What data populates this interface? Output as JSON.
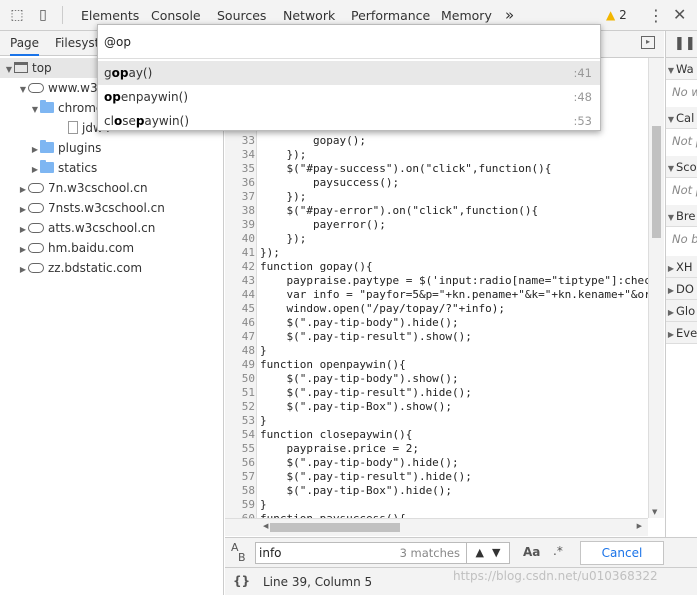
{
  "toolbar": {
    "tabs": [
      "Elements",
      "Console",
      "Sources",
      "Network",
      "Performance",
      "Memory"
    ],
    "more": "»",
    "warnings_count": "2"
  },
  "left_panel": {
    "tabs": [
      "Page",
      "Filesyste"
    ],
    "tree": [
      {
        "label": "top",
        "kind": "frame",
        "arrow": "▼"
      },
      {
        "label": "www.w3c",
        "kind": "cloud",
        "arrow": "▼"
      },
      {
        "label": "chrome",
        "kind": "folder",
        "arrow": "▼"
      },
      {
        "label": "jdw4",
        "kind": "file",
        "arrow": ""
      },
      {
        "label": "plugins",
        "kind": "folder",
        "arrow": "▶"
      },
      {
        "label": "statics",
        "kind": "folder",
        "arrow": "▶"
      },
      {
        "label": "7n.w3cschool.cn",
        "kind": "cloud",
        "arrow": "▶"
      },
      {
        "label": "7nsts.w3cschool.cn",
        "kind": "cloud",
        "arrow": "▶"
      },
      {
        "label": "atts.w3cschool.cn",
        "kind": "cloud",
        "arrow": "▶"
      },
      {
        "label": "hm.baidu.com",
        "kind": "cloud",
        "arrow": "▶"
      },
      {
        "label": "zz.bdstatic.com",
        "kind": "cloud",
        "arrow": "▶"
      }
    ]
  },
  "quick_open": {
    "query": "@op",
    "items": [
      {
        "pre": "g",
        "b1": "op",
        "mid": "ay()",
        "b2": "",
        "post": "",
        "line": ":41"
      },
      {
        "pre": "",
        "b1": "op",
        "mid": "enpaywin()",
        "b2": "",
        "post": "",
        "line": ":48"
      },
      {
        "pre": "cl",
        "b1": "o",
        "mid": "se",
        "b2": "p",
        "post": "aywin()",
        "line": ":53"
      }
    ]
  },
  "editor": {
    "lines": [
      {
        "n": "33",
        "t": "        gopay();"
      },
      {
        "n": "34",
        "t": "    });"
      },
      {
        "n": "35",
        "t": "    $(\"#pay-success\").on(\"click\",function(){"
      },
      {
        "n": "36",
        "t": "        paysuccess();"
      },
      {
        "n": "37",
        "t": "    });"
      },
      {
        "n": "38",
        "t": "    $(\"#pay-error\").on(\"click\",function(){"
      },
      {
        "n": "39",
        "t": "        payerror();"
      },
      {
        "n": "40",
        "t": "    });"
      },
      {
        "n": "41",
        "t": "});"
      },
      {
        "n": "42",
        "t": "function gopay(){"
      },
      {
        "n": "43",
        "t": "    paypraise.paytype = $('input:radio[name=\"tiptype\"]:chec"
      },
      {
        "n": "44",
        "t": "    var info = \"payfor=5&p=\"+kn.pename+\"&k=\"+kn.kename+\"&or"
      },
      {
        "n": "45",
        "t": "    window.open(\"/pay/topay/?\"+info);"
      },
      {
        "n": "46",
        "t": "    $(\".pay-tip-body\").hide();"
      },
      {
        "n": "47",
        "t": "    $(\".pay-tip-result\").show();"
      },
      {
        "n": "48",
        "t": "}"
      },
      {
        "n": "49",
        "t": "function openpaywin(){"
      },
      {
        "n": "50",
        "t": "    $(\".pay-tip-body\").show();"
      },
      {
        "n": "51",
        "t": "    $(\".pay-tip-result\").hide();"
      },
      {
        "n": "52",
        "t": "    $(\".pay-tip-Box\").show();"
      },
      {
        "n": "53",
        "t": "}"
      },
      {
        "n": "54",
        "t": "function closepaywin(){"
      },
      {
        "n": "55",
        "t": "    paypraise.price = 2;"
      },
      {
        "n": "56",
        "t": "    $(\".pay-tip-body\").hide();"
      },
      {
        "n": "57",
        "t": "    $(\".pay-tip-result\").hide();"
      },
      {
        "n": "58",
        "t": "    $(\".pay-tip-Box\").hide();"
      },
      {
        "n": "59",
        "t": "}"
      },
      {
        "n": "60",
        "t": "function paysuccess(){"
      }
    ]
  },
  "right_panel": {
    "sections": [
      {
        "label": "Wa",
        "note": "No w"
      },
      {
        "label": "Cal",
        "note": "Not p"
      },
      {
        "label": "Sco",
        "note": "Not p"
      },
      {
        "label": "Bre",
        "note": "No b"
      },
      {
        "label": "XH",
        "note": ""
      },
      {
        "label": "DO",
        "note": ""
      },
      {
        "label": "Glo",
        "note": ""
      },
      {
        "label": "Eve",
        "note": ""
      }
    ]
  },
  "search": {
    "value": "info",
    "matches": "3 matches",
    "aa": "Aa",
    "regex": ".*",
    "cancel": "Cancel"
  },
  "status": {
    "braces": "{}",
    "position": "Line 39, Column 5"
  },
  "watermark": "https://blog.csdn.net/u010368322"
}
